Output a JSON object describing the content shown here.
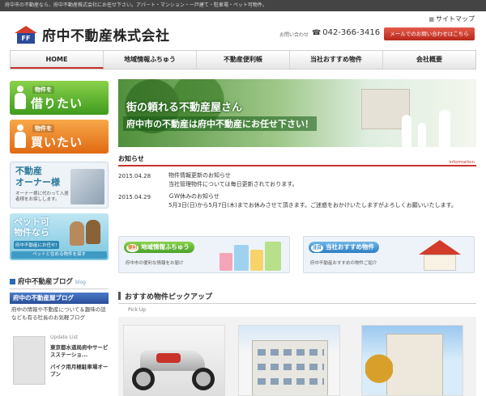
{
  "topbar": {
    "text": "府中市の不動産なら、府中不動産株式会社にお任せ下さい。アパート・マンション・一戸建て・駐車場・ペット可物件。"
  },
  "header": {
    "logo_mark": "FF",
    "company_name": "府中不動産株式会社",
    "sitemap_label": "サイトマップ",
    "contact_label": "お問い合わせ",
    "phone": "042-366-3416",
    "mail_button": "メールでのお問い合わせはこちら"
  },
  "nav": {
    "items": [
      {
        "label": "HOME"
      },
      {
        "label": "地域情報ふちゅう"
      },
      {
        "label": "不動産便利帳"
      },
      {
        "label": "当社おすすめ物件"
      },
      {
        "label": "会社概要"
      }
    ]
  },
  "sidebar": {
    "rent": {
      "small": "物件を",
      "big": "借りたい"
    },
    "buy": {
      "small": "物件を",
      "big": "買いたい"
    },
    "owner": {
      "title_line1": "不動産",
      "title_line2": "オーナー様",
      "sub": "オーナー様に代わって入居者様をお探しします。"
    },
    "pet": {
      "title_line1": "ペット可",
      "title_line2": "物件なら",
      "sub": "府中不動産にお任せ!",
      "bar": "ペットと住める物件を探す"
    },
    "blog": {
      "heading": "府中不動産ブログ",
      "heading_tag": "blog",
      "banner": "府中の不動産屋ブログ",
      "description": "府中の情報や不動産について＆趣味の話なども有る社長のお気軽ブログ",
      "update_title": "Update List",
      "updates": [
        "東京都水道局府中サービスステーショ...",
        "バイク用月極駐車場オープン"
      ]
    }
  },
  "hero": {
    "line1": "街の頼れる不動産屋さん",
    "line2": "府中市の不動産は府中不動産にお任せ下さい！"
  },
  "notice": {
    "heading": "お知らせ",
    "heading_en": "information",
    "items": [
      {
        "date": "2015.04.28",
        "title": "物件情報更新のお知らせ",
        "body": "当社管理物件については毎日更新されております。"
      },
      {
        "date": "2015.04.29",
        "title": "ＧＷ休みのお知らせ",
        "body": "5月3日(日)から5月7日(木)までお休みさせて頂きます。ご迷惑をおかけいたしますがよろしくお願いいたします。"
      }
    ]
  },
  "promos": [
    {
      "badge": "便利",
      "title": "地域情報ふちゅう",
      "sub": "府中市の便利な情報をお届け"
    },
    {
      "badge": "注目",
      "title": "当社おすすめ物件",
      "sub": "府中不動産おすすめの物件ご紹介"
    }
  ],
  "featured": {
    "heading": "おすすめ物件ピックアップ",
    "sub": "Pick Up"
  },
  "colors": {
    "accent_red": "#c8322a",
    "green": "#4aa22a",
    "orange": "#e06a12",
    "blue": "#2d7fc4"
  }
}
